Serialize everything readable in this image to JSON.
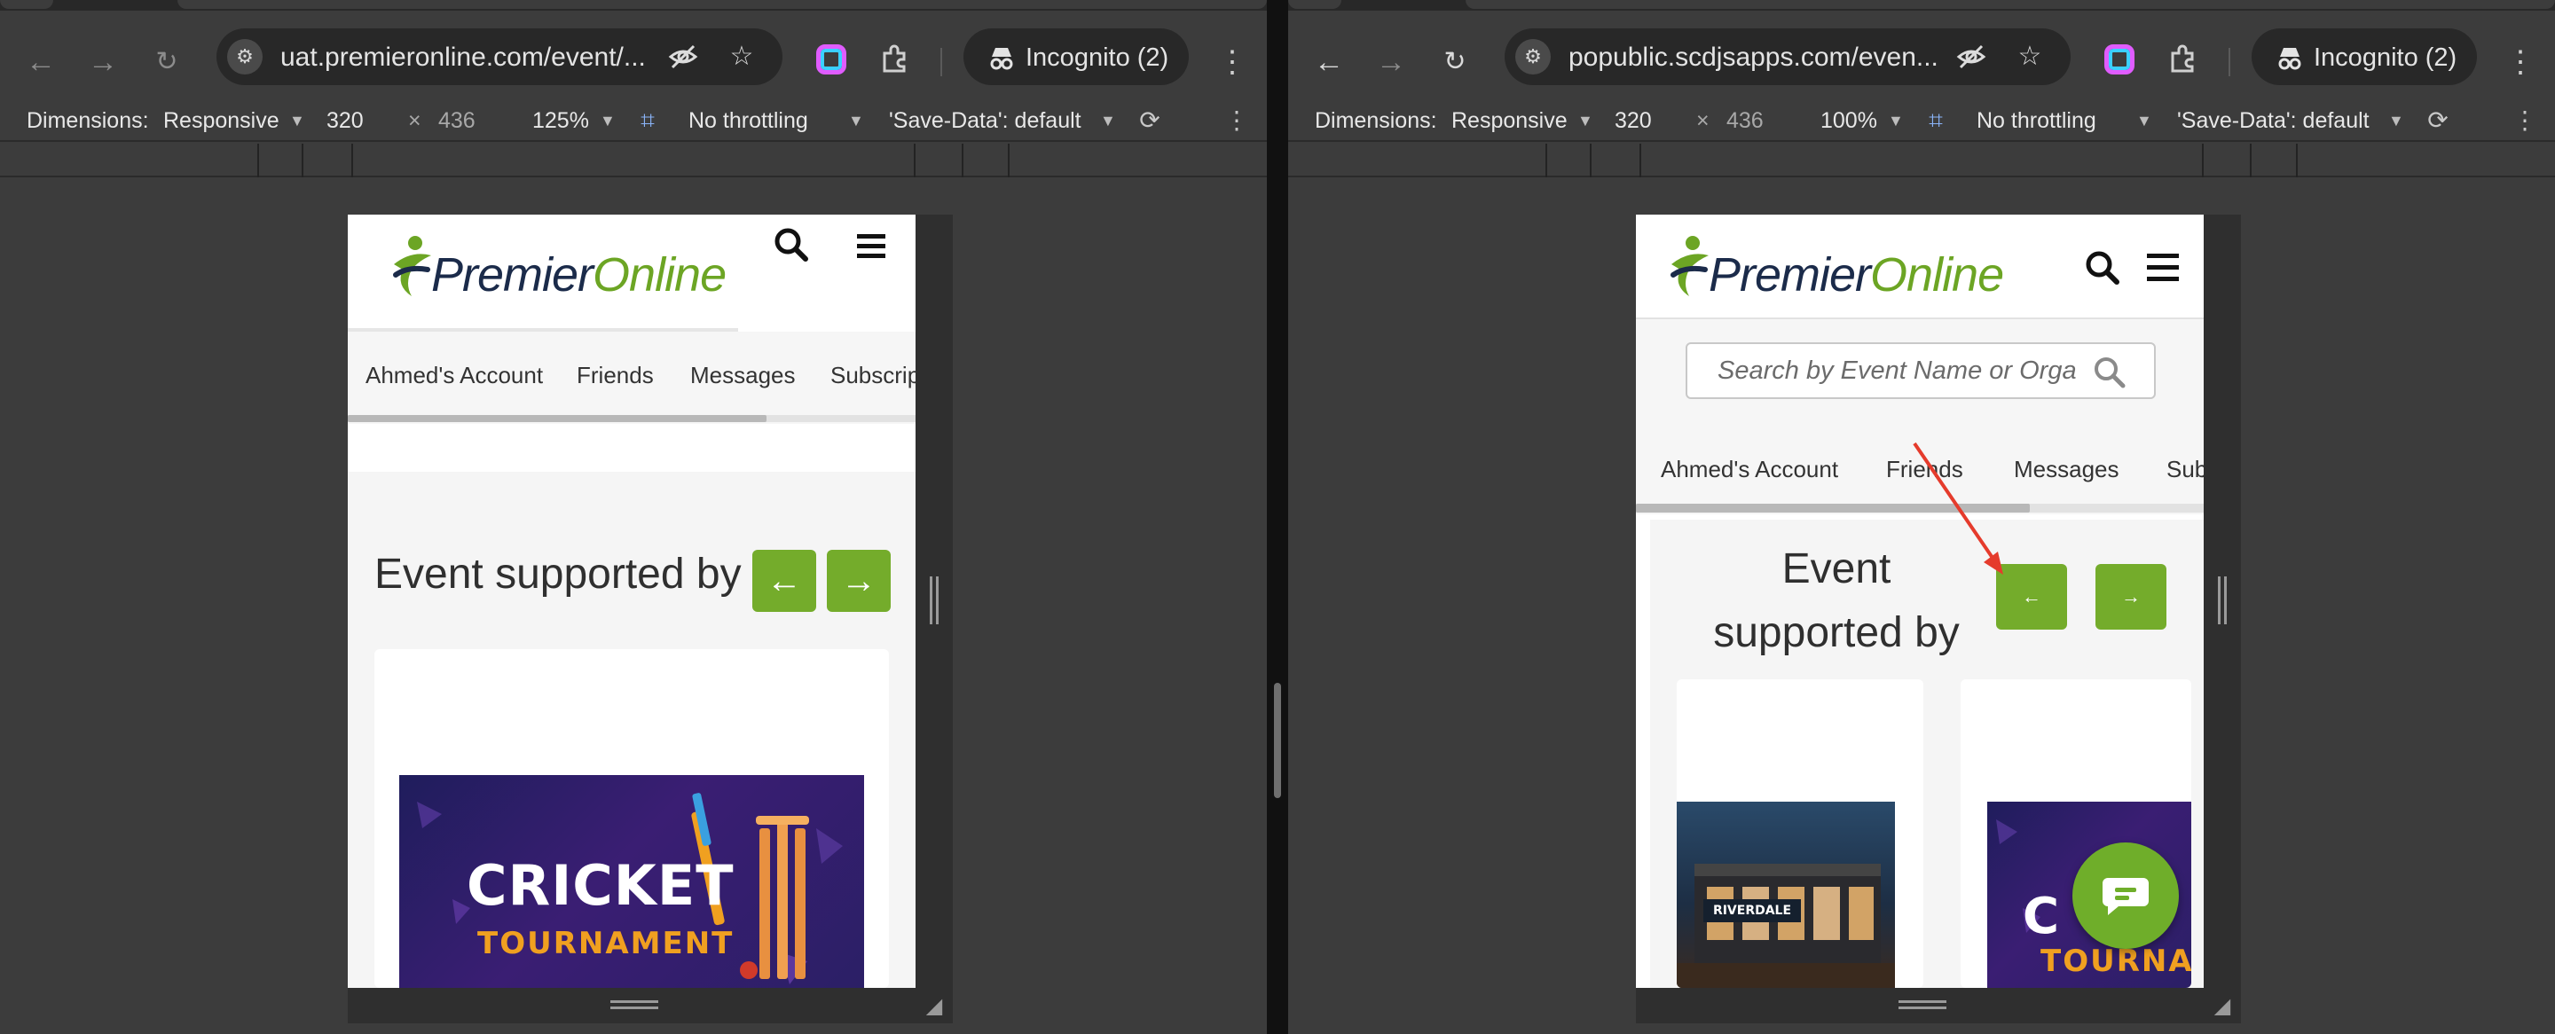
{
  "left": {
    "address": "uat.premieronline.com/event/...",
    "incognito": "Incognito (2)",
    "device": {
      "dimensions_label": "Dimensions:",
      "mode": "Responsive",
      "width": "320",
      "times": "×",
      "height": "436",
      "zoom": "125%",
      "throttling": "No throttling",
      "save_data": "'Save-Data': default"
    },
    "site": {
      "logo_part1": "Premier",
      "logo_part2": "Online",
      "nav": [
        "Ahmed's Account",
        "Friends",
        "Messages",
        "Subscrip"
      ],
      "section_title": "Event supported by",
      "prev": "←",
      "next": "→",
      "banner_line1": "CRICKET",
      "banner_line2": "TOURNAMENT"
    }
  },
  "right": {
    "address": "popublic.scdjsapps.com/even...",
    "incognito": "Incognito (2)",
    "device": {
      "dimensions_label": "Dimensions:",
      "mode": "Responsive",
      "width": "320",
      "times": "×",
      "height": "436",
      "zoom": "100%",
      "throttling": "No throttling",
      "save_data": "'Save-Data': default"
    },
    "site": {
      "logo_part1": "Premier",
      "logo_part2": "Online",
      "search_placeholder": "Search by Event Name or Orga",
      "nav": [
        "Ahmed's Account",
        "Friends",
        "Messages",
        "Sub"
      ],
      "section_title": "Event supported by",
      "prev": "←",
      "next": "→",
      "venue_sign": "RIVERDALE",
      "banner_line1": "C",
      "banner_line2": "TOURNA"
    }
  },
  "colors": {
    "brand_navy": "#1b2b4a",
    "brand_green": "#6ca524",
    "button_green": "#74ac2b",
    "annotation_red": "#e53b2c",
    "chrome_bg": "#3c3c3c"
  },
  "icons": [
    "back-icon",
    "forward-icon",
    "reload-icon",
    "site-settings-icon",
    "eye-off-icon",
    "star-icon",
    "extension-icon",
    "incognito-icon",
    "search-icon",
    "menu-icon",
    "chat-icon",
    "rotate-icon",
    "more-icon"
  ]
}
